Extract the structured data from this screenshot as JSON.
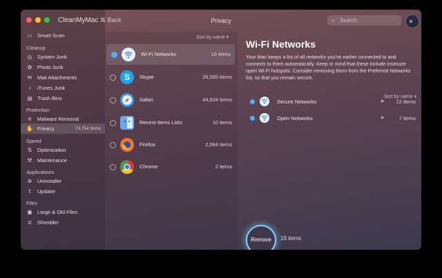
{
  "app": {
    "title": "CleanMyMac X",
    "back_label": "Back",
    "window_title": "Privacy"
  },
  "search": {
    "placeholder": "Search"
  },
  "sidebar": {
    "top": {
      "label": "Smart Scan",
      "icon": "smart-scan-icon"
    },
    "groups": [
      {
        "heading": "Cleanup",
        "items": [
          {
            "label": "System Junk"
          },
          {
            "label": "Photo Junk"
          },
          {
            "label": "Mail Attachments"
          },
          {
            "label": "iTunes Junk"
          },
          {
            "label": "Trash Bins"
          }
        ]
      },
      {
        "heading": "Protection",
        "items": [
          {
            "label": "Malware Removal"
          },
          {
            "label": "Privacy",
            "count": "73,754 items"
          }
        ]
      },
      {
        "heading": "Speed",
        "items": [
          {
            "label": "Optimization"
          },
          {
            "label": "Maintenance"
          }
        ]
      },
      {
        "heading": "Applications",
        "items": [
          {
            "label": "Uninstaller"
          },
          {
            "label": "Updater"
          }
        ]
      },
      {
        "heading": "Files",
        "items": [
          {
            "label": "Large & Old Files"
          },
          {
            "label": "Shredder"
          }
        ]
      }
    ]
  },
  "list": {
    "sort_label": "Sort by name ▾",
    "rows": [
      {
        "name": "Wi-Fi Networks",
        "count": "19 items",
        "checked": true
      },
      {
        "name": "Skype",
        "count": "26,505 items",
        "checked": false
      },
      {
        "name": "Safari",
        "count": "44,634 items",
        "checked": false
      },
      {
        "name": "Recent Items Lists",
        "count": "10 items",
        "checked": false
      },
      {
        "name": "Firefox",
        "count": "2,584 items",
        "checked": false
      },
      {
        "name": "Chrome",
        "count": "2 items",
        "checked": false
      }
    ]
  },
  "detail": {
    "title": "Wi-Fi Networks",
    "description": "Your Mac keeps a list of all networks you've earlier connected to and connects to them automatically. Keep in mind that these include insecure open Wi-Fi hotspots. Consider removing them from the Preferred Networks list, so that you remain secure.",
    "sort_label": "Sort by name ▾",
    "networks": [
      {
        "name": "Secure Networks",
        "count": "12 items"
      },
      {
        "name": "Open Networks",
        "count": "7 items"
      }
    ]
  },
  "action": {
    "remove_label": "Remove",
    "count": "19 items"
  },
  "colors": {
    "accent": "#4fb0ff",
    "ring": "#7fd3ff"
  }
}
